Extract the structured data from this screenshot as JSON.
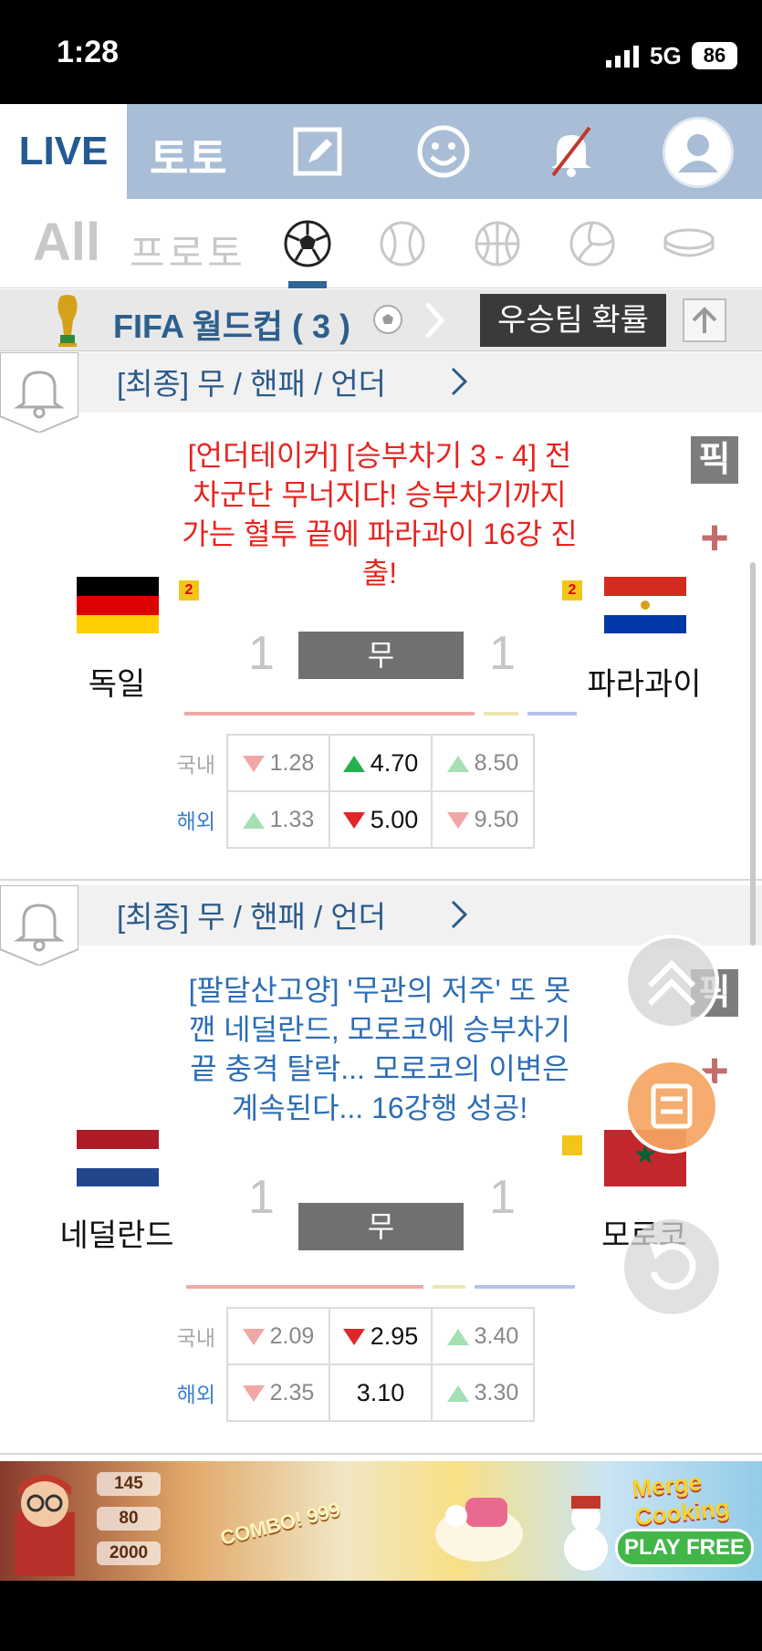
{
  "status_bar": {
    "time": "1:28",
    "network": "5G",
    "battery": "86"
  },
  "top_nav": {
    "live": "LIVE",
    "toto": "토토"
  },
  "sport_tabs": {
    "all": "All",
    "proto": "프로토"
  },
  "league": {
    "name": "FIFA 월드컵 ( 3 )",
    "win_prob": "우승팀 확률"
  },
  "matches": [
    {
      "status": "[최종] 무 / 핸패 / 언더",
      "headline": "[언더테이커] [승부차기 3 - 4] 전차군단 무너지다! 승부차기까지 가는 혈투 끝에 파라과이 16강 진출!",
      "headline_color": "#e8231e",
      "pick": "픽",
      "plus": "+",
      "home": {
        "name": "독일",
        "rank": "2",
        "score": "1"
      },
      "away": {
        "name": "파라과이",
        "rank": "2",
        "score": "1"
      },
      "result": "무",
      "odds": {
        "domestic_label": "국내",
        "overseas_label": "해외",
        "domestic": [
          {
            "value": "1.28",
            "trend": "down"
          },
          {
            "value": "4.70",
            "trend": "up",
            "strong": true
          },
          {
            "value": "8.50",
            "trend": "up"
          }
        ],
        "overseas": [
          {
            "value": "1.33",
            "trend": "up"
          },
          {
            "value": "5.00",
            "trend": "down",
            "strong": true
          },
          {
            "value": "9.50",
            "trend": "down"
          }
        ]
      }
    },
    {
      "status": "[최종] 무 / 핸패 / 언더",
      "headline": "[팔달산고양] '무관의 저주' 또 못 깬 네덜란드, 모로코에 승부차기 끝 충격 탈락... 모로코의 이변은 계속된다... 16강행 성공!",
      "headline_color": "#2c6db6",
      "pick": "픽",
      "plus": "+",
      "home": {
        "name": "네덜란드",
        "rank": "",
        "score": "1"
      },
      "away": {
        "name": "모로코",
        "rank": "",
        "score": "1"
      },
      "result": "무",
      "odds": {
        "domestic_label": "국내",
        "overseas_label": "해외",
        "domestic": [
          {
            "value": "2.09",
            "trend": "down"
          },
          {
            "value": "2.95",
            "trend": "down",
            "strong": true
          },
          {
            "value": "3.40",
            "trend": "up"
          }
        ],
        "overseas": [
          {
            "value": "2.35",
            "trend": "down"
          },
          {
            "value": "3.10",
            "trend": "none",
            "strong": true
          },
          {
            "value": "3.30",
            "trend": "up"
          }
        ]
      }
    }
  ],
  "ad": {
    "stat1": "145",
    "stat2": "80",
    "stat3": "2000",
    "combo": "COMBO! 999",
    "logo": "Merge Cooking",
    "cta": "PLAY FREE"
  }
}
